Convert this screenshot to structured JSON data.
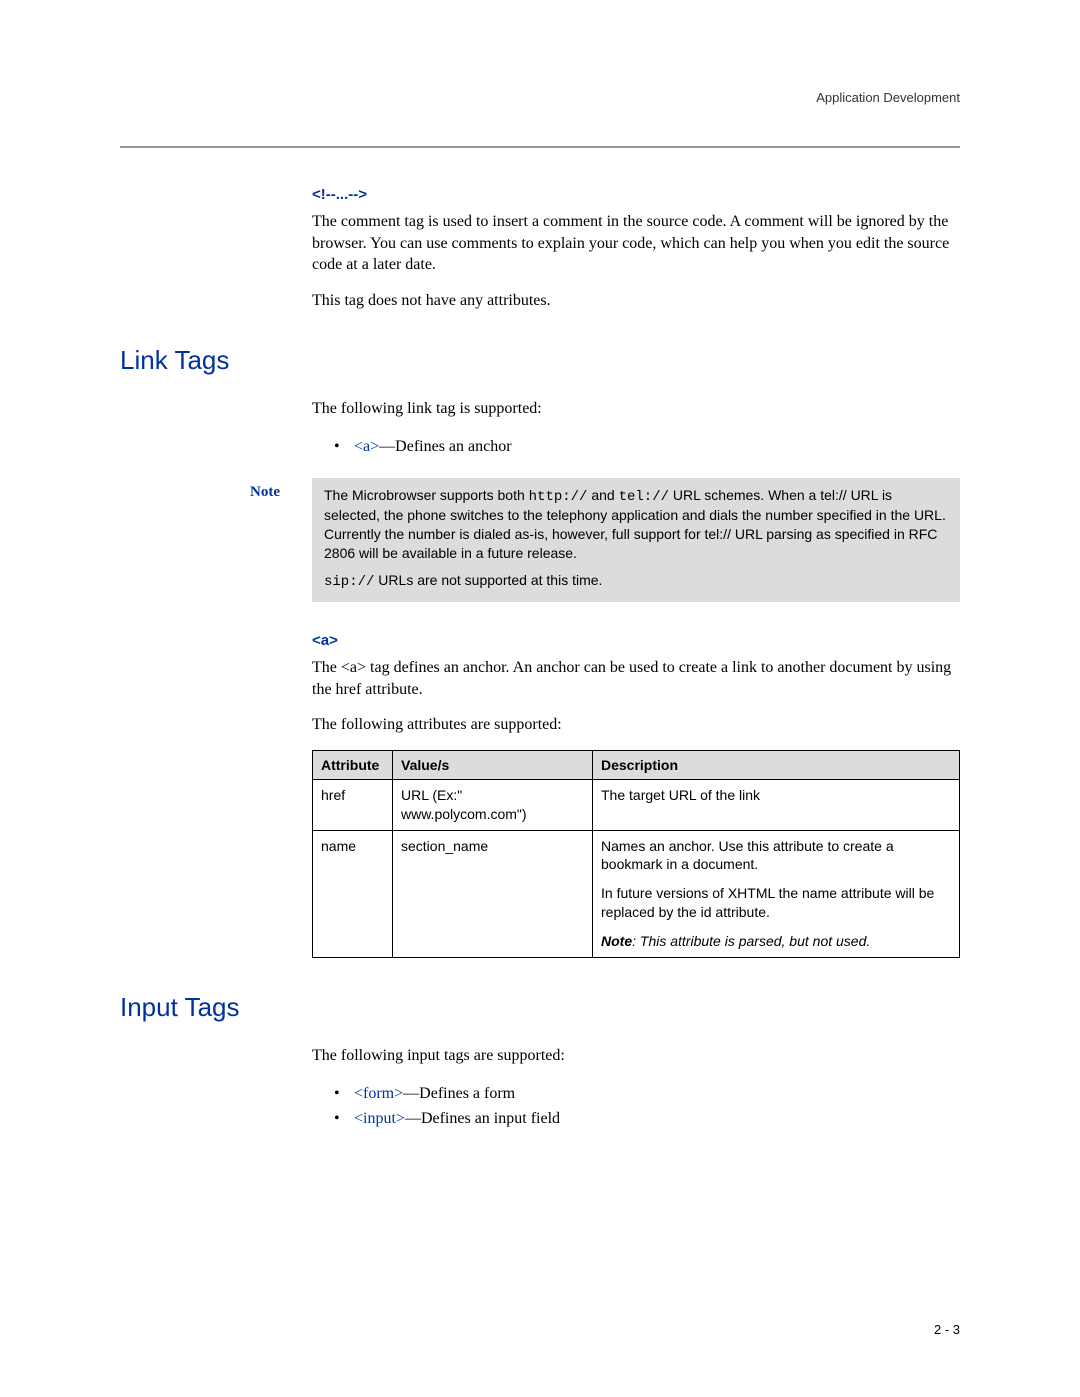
{
  "header": {
    "title": "Application Development"
  },
  "comment_section": {
    "heading": "<!--...-->",
    "p1": "The comment tag is used to insert a comment in the source code. A comment will be ignored by the browser. You can use comments to explain your code, which can help you when you edit the source code at a later date.",
    "p2": "This tag does not have any attributes."
  },
  "link_tags": {
    "heading": "Link Tags",
    "intro": "The following link tag is supported:",
    "bullet_tag": "<a>",
    "bullet_desc": "—Defines an anchor"
  },
  "note": {
    "label": "Note",
    "p1_a": "The Microbrowser supports both ",
    "p1_http": "http://",
    "p1_b": " and ",
    "p1_tel": "tel://",
    "p1_c": " URL schemes. When a tel:// URL is selected, the phone switches to the telephony application and dials the number specified in the URL. Currently the number is dialed as-is, however, full support for tel:// URL parsing as specified in RFC 2806 will be available in a future release.",
    "p2_sip": "sip://",
    "p2_rest": " URLs are not supported at this time."
  },
  "anchor_section": {
    "heading": "<a>",
    "p1": "The <a> tag defines an anchor. An anchor can be used to create a link to another document by using the href attribute.",
    "p2": "The following attributes are supported:"
  },
  "table": {
    "headers": {
      "c1": "Attribute",
      "c2": "Value/s",
      "c3": "Description"
    },
    "rows": [
      {
        "attr": "href",
        "value": "URL (Ex:\" www.polycom.com\")",
        "desc": [
          {
            "text": "The target URL of the link"
          }
        ]
      },
      {
        "attr": "name",
        "value": "section_name",
        "desc": [
          {
            "text": "Names an anchor. Use this attribute to create a bookmark in a document."
          },
          {
            "text": "In future versions of XHTML the name attribute will be replaced by the id attribute."
          },
          {
            "note_label": "Note",
            "note_rest": ": This attribute is parsed, but not used."
          }
        ]
      }
    ]
  },
  "input_tags": {
    "heading": "Input Tags",
    "intro": "The following input tags are supported:",
    "bullets": [
      {
        "tag": "<form>",
        "desc": "—Defines a form"
      },
      {
        "tag": "<input>",
        "desc": "—Defines an input field"
      }
    ]
  },
  "page_number": "2 - 3"
}
